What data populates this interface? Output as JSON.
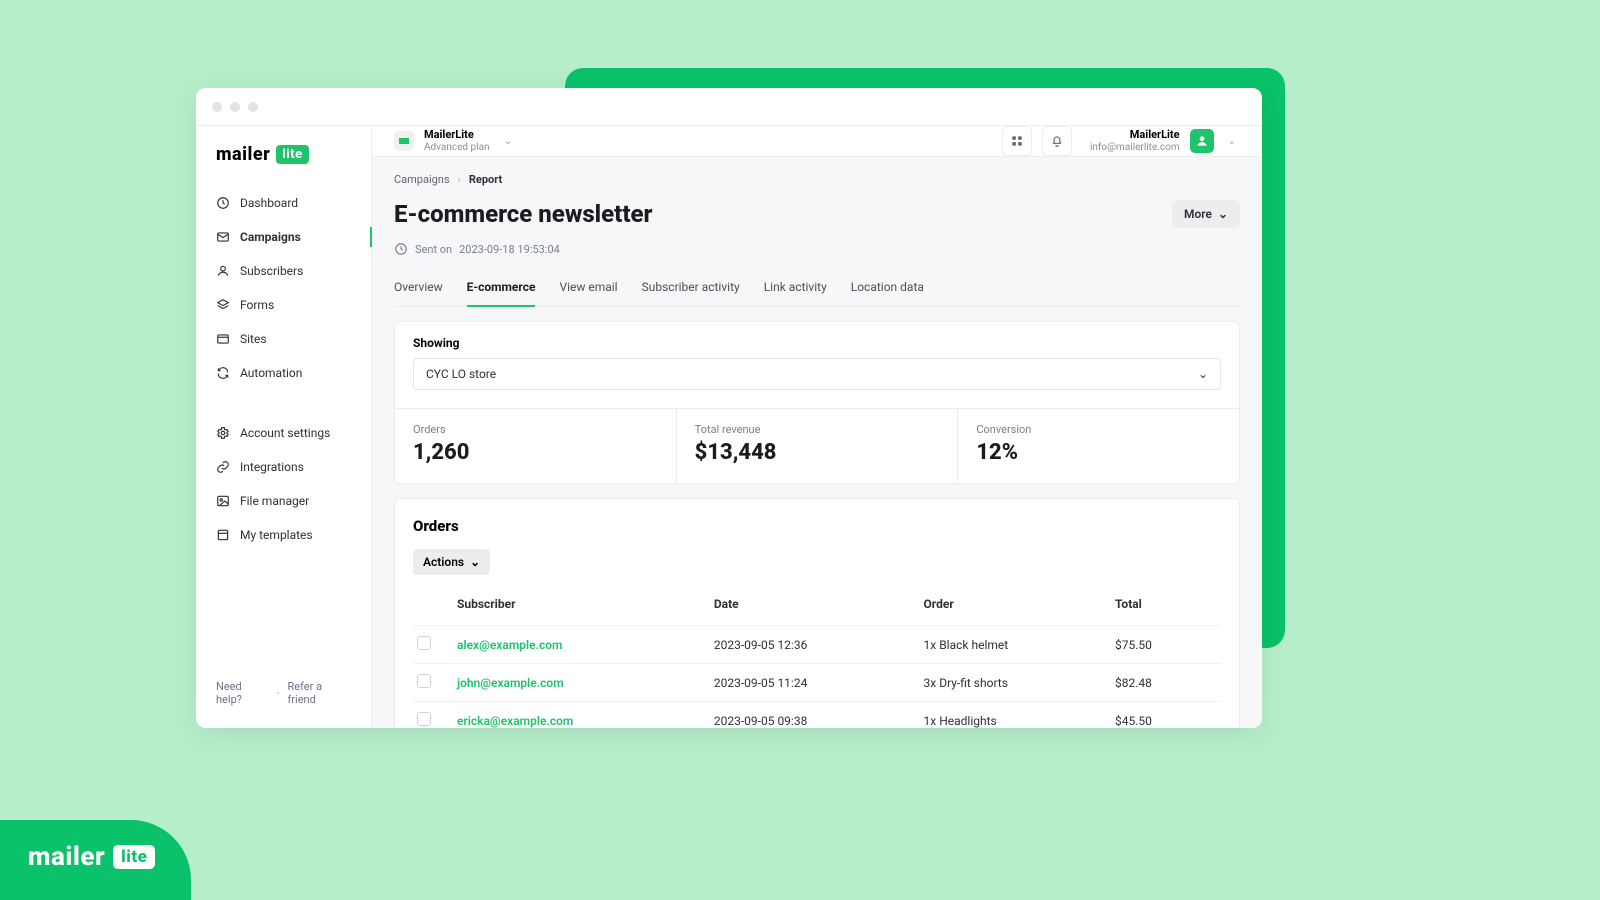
{
  "brand": {
    "name": "mailer",
    "badge": "lite"
  },
  "sidebar": {
    "items": [
      {
        "label": "Dashboard"
      },
      {
        "label": "Campaigns"
      },
      {
        "label": "Subscribers"
      },
      {
        "label": "Forms"
      },
      {
        "label": "Sites"
      },
      {
        "label": "Automation"
      }
    ],
    "settings": [
      {
        "label": "Account settings"
      },
      {
        "label": "Integrations"
      },
      {
        "label": "File manager"
      },
      {
        "label": "My templates"
      }
    ],
    "help_label": "Need help?",
    "refer_label": "Refer a friend"
  },
  "topbar": {
    "account_name": "MailerLite",
    "account_plan": "Advanced plan",
    "user_name": "MailerLite",
    "user_email": "info@mailerlite.com"
  },
  "breadcrumbs": {
    "root": "Campaigns",
    "current": "Report"
  },
  "page_title": "E-commerce newsletter",
  "more_label": "More",
  "sent_prefix": "Sent on",
  "sent_timestamp": "2023-09-18 19:53:04",
  "tabs": [
    "Overview",
    "E-commerce",
    "View email",
    "Subscriber activity",
    "Link activity",
    "Location data"
  ],
  "showing": {
    "label": "Showing",
    "value": "CYC LO store"
  },
  "stats": {
    "orders_label": "Orders",
    "orders_value": "1,260",
    "revenue_label": "Total revenue",
    "revenue_value": "$13,448",
    "conversion_label": "Conversion",
    "conversion_value": "12%"
  },
  "orders": {
    "title": "Orders",
    "actions_label": "Actions",
    "headers": {
      "subscriber": "Subscriber",
      "date": "Date",
      "order": "Order",
      "total": "Total"
    },
    "rows": [
      {
        "subscriber": "alex@example.com",
        "date": "2023-09-05 12:36",
        "order": "1x Black helmet",
        "total": "$75.50"
      },
      {
        "subscriber": "john@example.com",
        "date": "2023-09-05 11:24",
        "order": "3x Dry-fit shorts",
        "total": "$82.48"
      },
      {
        "subscriber": "ericka@example.com",
        "date": "2023-09-05 09:38",
        "order": "1x Headlights",
        "total": "$45.50"
      }
    ]
  },
  "colors": {
    "accent": "#1ec36a",
    "brand_green": "#09c269"
  }
}
